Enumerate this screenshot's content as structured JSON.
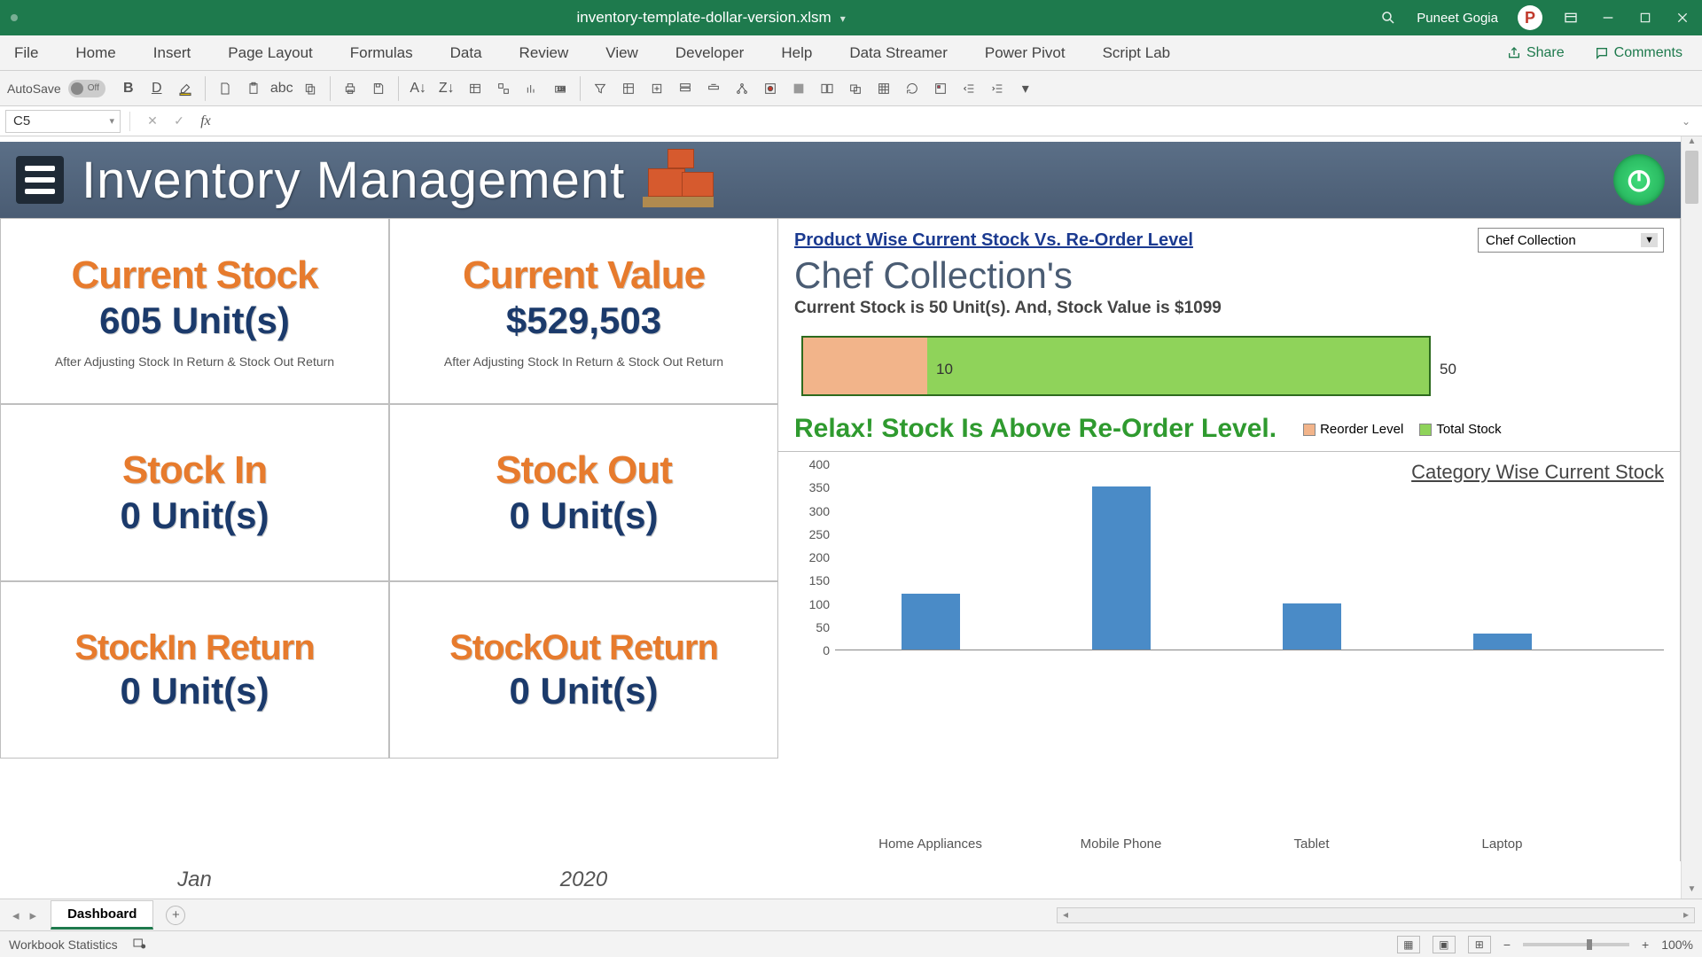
{
  "titlebar": {
    "filename": "inventory-template-dollar-version.xlsm",
    "user_name": "Puneet Gogia",
    "avatar_letter": "P"
  },
  "ribbon": {
    "tabs": [
      "File",
      "Home",
      "Insert",
      "Page Layout",
      "Formulas",
      "Data",
      "Review",
      "View",
      "Developer",
      "Help",
      "Data Streamer",
      "Power Pivot",
      "Script Lab"
    ],
    "share": "Share",
    "comments": "Comments"
  },
  "qat": {
    "autosave_label": "AutoSave",
    "autosave_state": "Off"
  },
  "formula": {
    "cell_ref": "C5",
    "value": ""
  },
  "dashboard": {
    "title": "Inventory Management",
    "panels": {
      "current_stock": {
        "title": "Current Stock",
        "value": "605 Unit(s)",
        "note": "After Adjusting Stock In Return & Stock Out Return"
      },
      "current_value": {
        "title": "Current Value",
        "value": "$529,503",
        "note": "After Adjusting Stock In Return & Stock Out Return"
      },
      "stock_in": {
        "title": "Stock In",
        "value": "0 Unit(s)"
      },
      "stock_out": {
        "title": "Stock Out",
        "value": "0 Unit(s)"
      },
      "stockin_return": {
        "title": "StockIn Return",
        "value": "0 Unit(s)"
      },
      "stockout_return": {
        "title": "StockOut Return",
        "value": "0 Unit(s)"
      }
    },
    "footer": {
      "month": "Jan",
      "year": "2020"
    },
    "right": {
      "link_title": "Product Wise Current Stock Vs. Re-Order Level",
      "dropdown_value": "Chef Collection",
      "product_name": "Chef Collection's",
      "subtext": "Current Stock is 50 Unit(s). And, Stock Value is $1099",
      "hbar": {
        "reorder": 10,
        "stock": 50,
        "label_reorder": "10",
        "label_stock": "50"
      },
      "status_msg": "Relax! Stock Is Above Re-Order Level.",
      "legend": {
        "reorder": "Reorder Level",
        "total": "Total Stock"
      },
      "cat_chart_title": "Category Wise Current Stock"
    }
  },
  "chart_data": {
    "type": "bar",
    "title": "Category Wise Current Stock",
    "categories": [
      "Home Appliances",
      "Mobile Phone",
      "Tablet",
      "Laptop"
    ],
    "values": [
      120,
      350,
      100,
      35
    ],
    "ylim": [
      0,
      400
    ],
    "yticks": [
      0,
      50,
      100,
      150,
      200,
      250,
      300,
      350,
      400
    ],
    "xlabel": "",
    "ylabel": ""
  },
  "sheet_tabs": {
    "active": "Dashboard"
  },
  "statusbar": {
    "left": "Workbook Statistics",
    "zoom": "100%"
  }
}
